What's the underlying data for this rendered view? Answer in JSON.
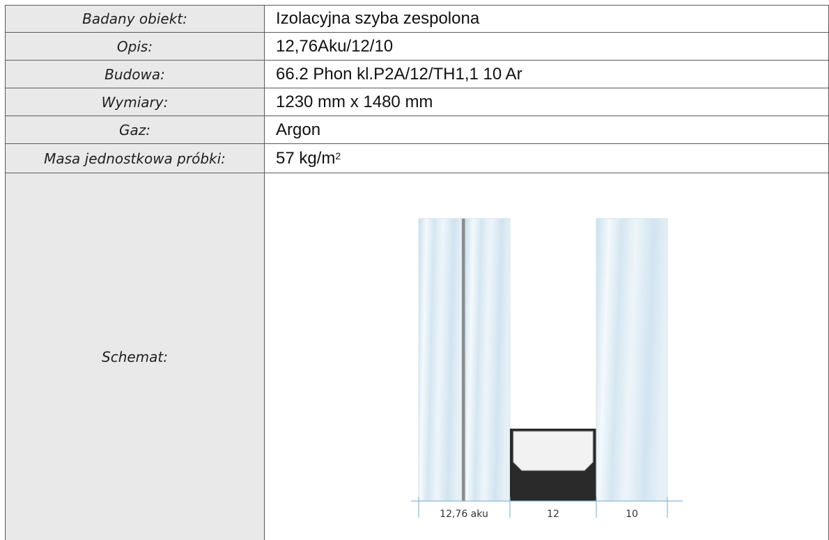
{
  "rows": [
    {
      "label": "Badany obiekt:",
      "value": "Izolacyjna szyba zespolona"
    },
    {
      "label": "Opis:",
      "value": "12,76Aku/12/10"
    },
    {
      "label": "Budowa:",
      "value": "66.2 Phon kl.P2A/12/TH1,1 10 Ar"
    },
    {
      "label": "Wymiary:",
      "value": "1230 mm x 1480 mm"
    },
    {
      "label": "Gaz:",
      "value": "Argon"
    },
    {
      "label": "Masa jednostkowa próbki:",
      "value": "57 kg/m",
      "value_sup": "2"
    }
  ],
  "schema_row": {
    "label": "Schemat:"
  },
  "schema": {
    "dim_labels": [
      "12,76 aku",
      "12",
      "10"
    ],
    "colors": {
      "glass": "#dbe9f2",
      "spacer": "#2a2a2a",
      "interlayer": "#8c8c8c",
      "dim_line": "#8fb6d3"
    }
  }
}
